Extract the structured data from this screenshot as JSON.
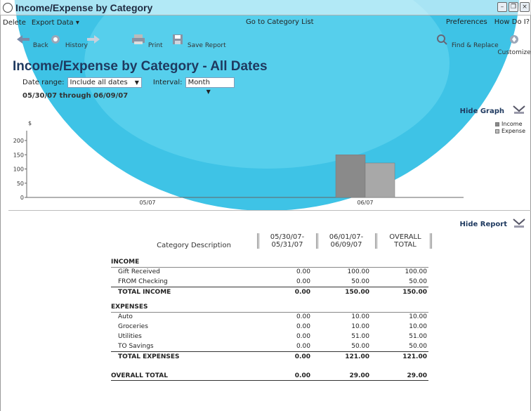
{
  "window": {
    "title": "Income/Expense by Category"
  },
  "menu": {
    "delete": "Delete",
    "export": "Export Data ▾",
    "center": "Go to Category List",
    "preferences": "Preferences",
    "howdoi": "How Do I?"
  },
  "toolbar": {
    "back": "Back",
    "history": "History",
    "forward": "",
    "print": "Print",
    "save": "Save Report",
    "find": "Find & Replace",
    "customize": "Customize"
  },
  "report": {
    "title": "Income/Expense by Category - All Dates",
    "date_range_label": "Date range:",
    "date_range_value": "Include all dates",
    "interval_label": "Interval:",
    "interval_value": "Month",
    "date_span": "05/30/07 through 06/09/07",
    "hide_graph": "Hide Graph",
    "hide_report": "Hide Report"
  },
  "chart_data": {
    "type": "bar",
    "categories": [
      "05/07",
      "06/07"
    ],
    "series": [
      {
        "name": "Income",
        "values": [
          0,
          150
        ]
      },
      {
        "name": "Expense",
        "values": [
          0,
          121
        ]
      }
    ],
    "ylabel": "$",
    "ylim": [
      0,
      200
    ],
    "yticks": [
      "0",
      "50",
      "100",
      "150",
      "200"
    ],
    "legend": "top-right",
    "colors": {
      "income": "#8a8a8a",
      "expense": "#a8a8a8"
    }
  },
  "table": {
    "headers": {
      "desc": "Category Description",
      "col1_line1": "05/30/07-",
      "col1_line2": "05/31/07",
      "col2_line1": "06/01/07-",
      "col2_line2": "06/09/07",
      "col3_line1": "OVERALL",
      "col3_line2": "TOTAL"
    },
    "income_label": "INCOME",
    "income_rows": [
      {
        "name": "Gift Received",
        "c1": "0.00",
        "c2": "100.00",
        "c3": "100.00"
      },
      {
        "name": "FROM Checking",
        "c1": "0.00",
        "c2": "50.00",
        "c3": "50.00"
      }
    ],
    "income_total": {
      "name": "TOTAL INCOME",
      "c1": "0.00",
      "c2": "150.00",
      "c3": "150.00"
    },
    "expense_label": "EXPENSES",
    "expense_rows": [
      {
        "name": "Auto",
        "c1": "0.00",
        "c2": "10.00",
        "c3": "10.00"
      },
      {
        "name": "Groceries",
        "c1": "0.00",
        "c2": "10.00",
        "c3": "10.00"
      },
      {
        "name": "Utilities",
        "c1": "0.00",
        "c2": "51.00",
        "c3": "51.00"
      },
      {
        "name": "TO Savings",
        "c1": "0.00",
        "c2": "50.00",
        "c3": "50.00"
      }
    ],
    "expense_total": {
      "name": "TOTAL EXPENSES",
      "c1": "0.00",
      "c2": "121.00",
      "c3": "121.00"
    },
    "overall": {
      "name": "OVERALL TOTAL",
      "c1": "0.00",
      "c2": "29.00",
      "c3": "29.00"
    }
  }
}
